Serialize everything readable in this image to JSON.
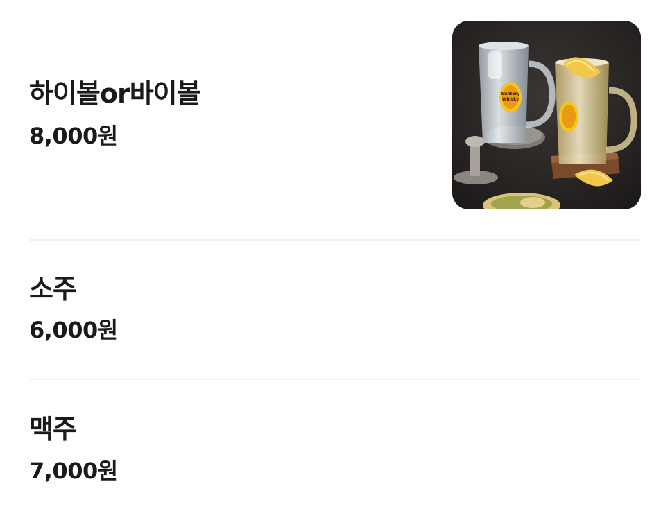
{
  "menu": {
    "items": [
      {
        "name": "하이볼or바이볼",
        "price": "8,000원"
      },
      {
        "name": "소주",
        "price": "6,000원"
      },
      {
        "name": "맥주",
        "price": "7,000원"
      }
    ]
  },
  "photo": {
    "label_line1": "Suntory",
    "label_line2": "Whisky"
  },
  "colors": {
    "text": "#1a1a1a",
    "divider": "#f1f1f1",
    "photo_background": "#2a2726",
    "lemon": "#f2c84b",
    "label_yellow": "#f5c518"
  }
}
